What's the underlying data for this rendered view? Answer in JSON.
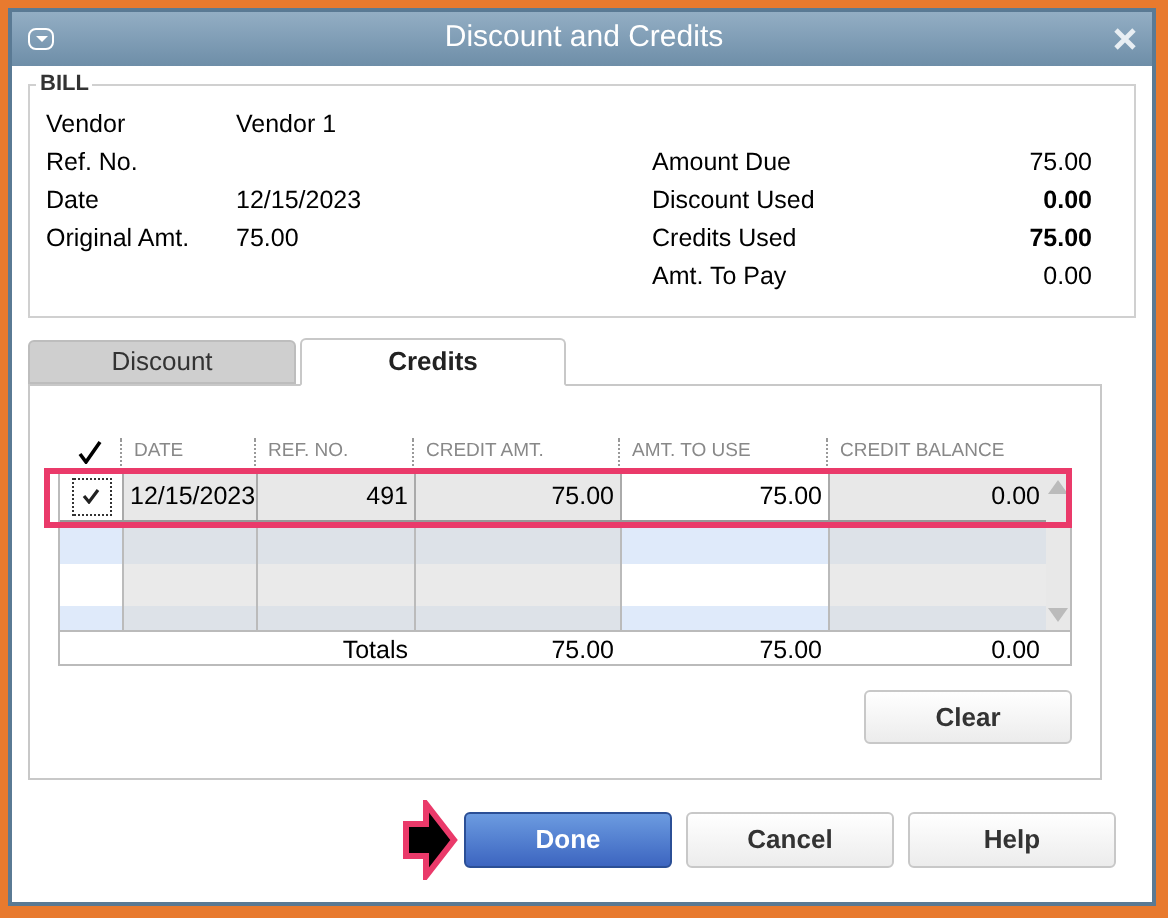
{
  "window": {
    "title": "Discount and Credits"
  },
  "bill": {
    "legend": "BILL",
    "left_fields": [
      {
        "label": "Vendor",
        "value": "Vendor 1"
      },
      {
        "label": "Ref. No."
      },
      {
        "label": "Date",
        "value": "12/15/2023"
      },
      {
        "label": "Original Amt.",
        "value": "75.00"
      }
    ],
    "right_fields": [
      {
        "label": "Amount Due",
        "value": "75.00",
        "bold": false
      },
      {
        "label": "Discount Used",
        "value": "0.00",
        "bold": true
      },
      {
        "label": "Credits Used",
        "value": "75.00",
        "bold": true
      },
      {
        "label": "Amt. To Pay",
        "value": "0.00",
        "bold": false
      }
    ]
  },
  "tabs": [
    {
      "label": "Discount",
      "selected": false
    },
    {
      "label": "Credits",
      "selected": true
    }
  ],
  "table": {
    "columns": [
      "DATE",
      "REF. NO.",
      "CREDIT AMT.",
      "AMT. TO USE",
      "CREDIT BALANCE"
    ],
    "rows": [
      {
        "checked": true,
        "highlighted": true,
        "cells": [
          "12/15/2023",
          "491",
          "75.00",
          "75.00",
          "0.00"
        ]
      }
    ],
    "totals": {
      "label": "Totals",
      "values": [
        "75.00",
        "75.00",
        "0.00"
      ]
    }
  },
  "clear_button": "Clear",
  "buttons": [
    {
      "label": "Done",
      "kind": "primary",
      "pointed": true
    },
    {
      "label": "Cancel",
      "kind": "default",
      "pointed": false
    },
    {
      "label": "Help",
      "kind": "default",
      "pointed": false
    }
  ]
}
